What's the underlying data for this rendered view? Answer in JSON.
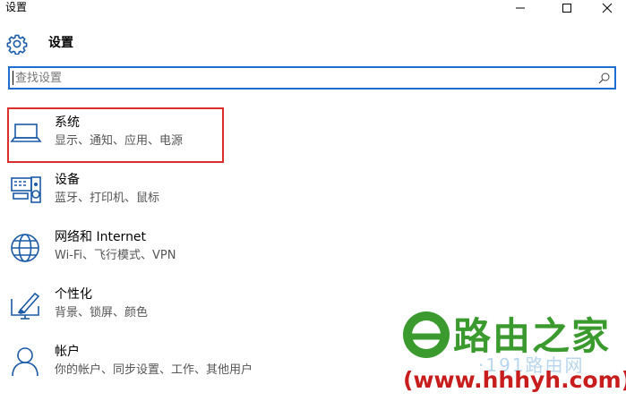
{
  "window": {
    "title": "设置",
    "controls": [
      "minimize-icon",
      "maximize-icon",
      "close-icon"
    ]
  },
  "header": {
    "icon": "gear-icon",
    "title": "设置"
  },
  "search": {
    "placeholder": "查找设置",
    "value": "",
    "icon": "search-icon"
  },
  "items": [
    {
      "icon": "laptop-icon",
      "title": "系统",
      "subtitle": "显示、通知、应用、电源",
      "highlighted": true
    },
    {
      "icon": "devices-icon",
      "title": "设备",
      "subtitle": "蓝牙、打印机、鼠标"
    },
    {
      "icon": "globe-icon",
      "title": "网络和 Internet",
      "subtitle": "Wi-Fi、飞行模式、VPN"
    },
    {
      "icon": "personalization-icon",
      "title": "个性化",
      "subtitle": "背景、锁屏、颜色"
    },
    {
      "icon": "person-icon",
      "title": "帐户",
      "subtitle": "你的帐户、同步设置、工作、其他用户"
    }
  ],
  "watermark": {
    "name": "路由之家",
    "background_text": "·191路由网",
    "url": "(www.hhhyh.com)",
    "colors": {
      "green": "#3a9a2d",
      "red": "#c81d1d"
    }
  },
  "colors": {
    "accent": "#1f6ed4",
    "highlight_border": "#d9302b",
    "icon_blue": "#1a5aa6"
  }
}
